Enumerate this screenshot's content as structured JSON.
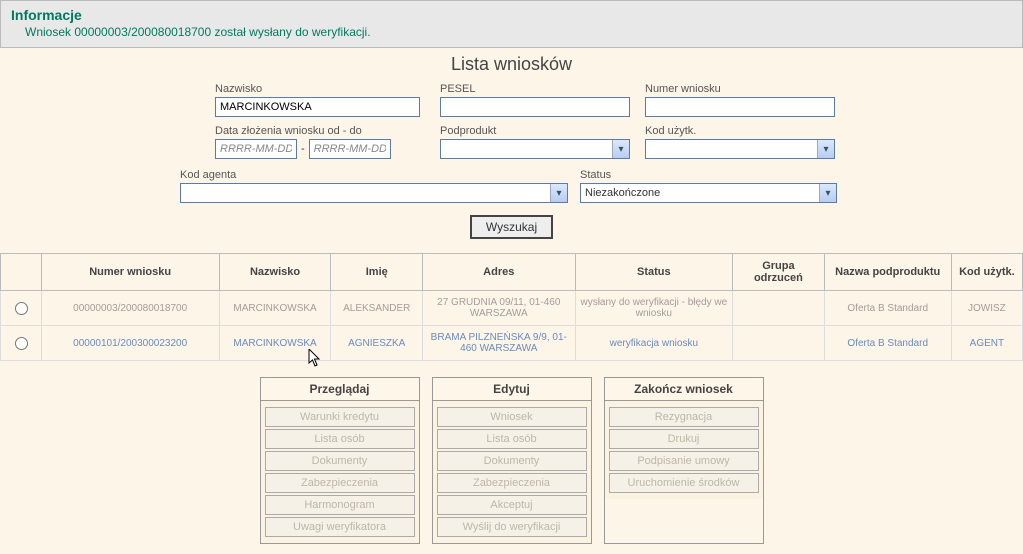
{
  "info": {
    "heading": "Informacje",
    "message": "Wniosek 00000003/200080018700 został wysłany do weryfikacji."
  },
  "title": "Lista wniosków",
  "filter": {
    "nazwisko_label": "Nazwisko",
    "nazwisko_value": "MARCINKOWSKA",
    "pesel_label": "PESEL",
    "pesel_value": "",
    "numer_label": "Numer wniosku",
    "numer_value": "",
    "data_label": "Data złożenia wniosku od - do",
    "data_placeholder": "RRRR-MM-DD",
    "data_from": "",
    "data_to": "",
    "podprodukt_label": "Podprodukt",
    "podprodukt_value": "",
    "kod_uzytk_label": "Kod użytk.",
    "kod_uzytk_value": "",
    "kod_agenta_label": "Kod agenta",
    "kod_agenta_value": "",
    "status_label": "Status",
    "status_value": "Niezakończone",
    "search_button": "Wyszukaj"
  },
  "table": {
    "headers": {
      "sel": "",
      "numer": "Numer wniosku",
      "nazwisko": "Nazwisko",
      "imie": "Imię",
      "adres": "Adres",
      "status": "Status",
      "grupa": "Grupa odrzuceń",
      "nazwa": "Nazwa podproduktu",
      "kod": "Kod użytk."
    },
    "rows": [
      {
        "numer": "00000003/200080018700",
        "nazwisko": "MARCINKOWSKA",
        "imie": "ALEKSANDER",
        "adres": "27 GRUDNIA 09/11, 01-460 WARSZAWA",
        "status": "wysłany do weryfikacji - błędy we wniosku",
        "grupa": "",
        "nazwa": "Oferta B Standard",
        "kod": "JOWISZ"
      },
      {
        "numer": "00000101/200300023200",
        "nazwisko": "MARCINKOWSKA",
        "imie": "AGNIESZKA",
        "adres": "BRAMA PILZNEŃSKA 9/9, 01-460 WARSZAWA",
        "status": "weryfikacja wniosku",
        "grupa": "",
        "nazwa": "Oferta B Standard",
        "kod": "AGENT"
      }
    ]
  },
  "actions": {
    "przegladaj": {
      "title": "Przeglądaj",
      "items": [
        "Warunki kredytu",
        "Lista osób",
        "Dokumenty",
        "Zabezpieczenia",
        "Harmonogram",
        "Uwagi weryfikatora"
      ]
    },
    "edytuj": {
      "title": "Edytuj",
      "items": [
        "Wniosek",
        "Lista osób",
        "Dokumenty",
        "Zabezpieczenia",
        "Akceptuj",
        "Wyślij do weryfikacji"
      ]
    },
    "zakoncz": {
      "title": "Zakończ wniosek",
      "items": [
        "Rezygnacja",
        "Drukuj",
        "Podpisanie umowy",
        "Uruchomienie środków"
      ]
    }
  }
}
